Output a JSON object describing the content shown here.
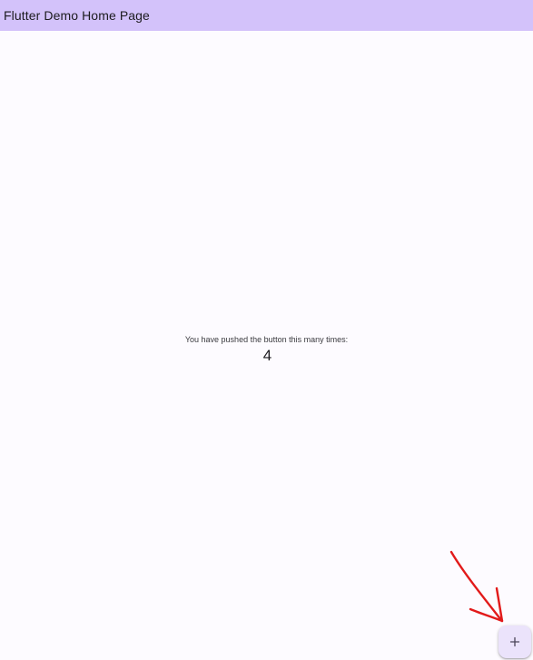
{
  "app_bar": {
    "title": "Flutter Demo Home Page"
  },
  "main": {
    "counter_label": "You have pushed the button this many times:",
    "counter_value": "4"
  },
  "fab": {
    "icon": "add-icon"
  },
  "annotation": {
    "type": "hand-drawn-arrow",
    "color": "#e21a1a"
  },
  "colors": {
    "app_bar_bg": "#d3c2fa",
    "page_bg": "#fdfbff",
    "fab_bg": "#ebe3fb",
    "text": "#1c1b1f"
  }
}
